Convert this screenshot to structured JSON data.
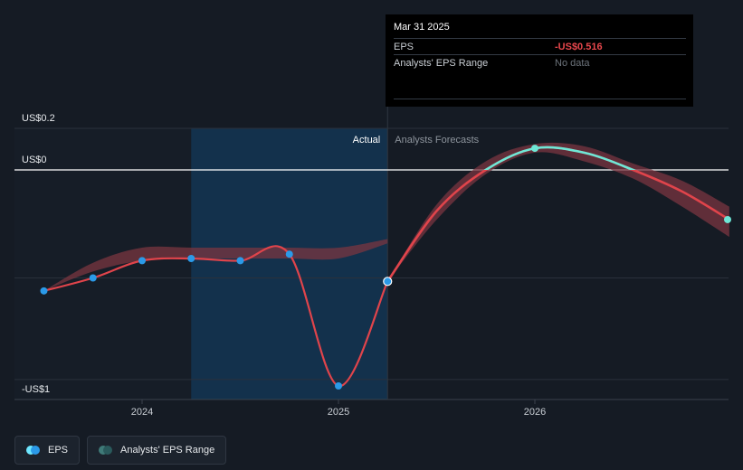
{
  "chart_data": {
    "type": "line",
    "y_tick_labels": {
      "top": "US$0.2",
      "zero": "US$0",
      "bottom": "-US$1"
    },
    "ylim": [
      -1,
      0.2
    ],
    "x_tick_labels": [
      "2024",
      "2025",
      "2026"
    ],
    "x_ticks": [
      2024.0,
      2025.0,
      2026.0
    ],
    "xlim": [
      2023.3,
      2026.99
    ],
    "actual_label": "Actual",
    "forecast_label": "Analysts Forecasts",
    "forecast_start": 2025.25,
    "highlight_start": 2024.25,
    "series": [
      {
        "name": "EPS",
        "x": [
          2023.5,
          2023.75,
          2024.0,
          2024.25,
          2024.5,
          2024.75,
          2025.0,
          2025.25
        ],
        "y": [
          -0.56,
          -0.5,
          -0.42,
          -0.41,
          -0.42,
          -0.39,
          -1.0,
          -0.516
        ]
      },
      {
        "name": "EPS forecast",
        "x": [
          2025.25,
          2025.5,
          2025.75,
          2026.0,
          2026.25,
          2026.5,
          2026.75,
          2026.99
        ],
        "y": [
          -0.516,
          -0.19,
          0.0,
          0.1,
          0.08,
          0.0,
          -0.1,
          -0.23
        ]
      }
    ],
    "range_band_hist": {
      "x": [
        2023.5,
        2023.75,
        2024.0,
        2024.25,
        2024.5,
        2024.75,
        2025.0,
        2025.25
      ],
      "low": [
        -0.56,
        -0.47,
        -0.42,
        -0.41,
        -0.41,
        -0.41,
        -0.41,
        -0.34
      ],
      "high": [
        -0.56,
        -0.43,
        -0.36,
        -0.36,
        -0.36,
        -0.36,
        -0.36,
        -0.32
      ]
    },
    "range_band_forecast": {
      "x": [
        2025.25,
        2025.5,
        2025.75,
        2026.0,
        2026.25,
        2026.5,
        2026.75,
        2026.99
      ],
      "low": [
        -0.516,
        -0.23,
        -0.02,
        0.08,
        0.04,
        -0.04,
        -0.17,
        -0.31
      ],
      "high": [
        -0.516,
        -0.16,
        0.04,
        0.12,
        0.11,
        0.03,
        -0.05,
        -0.17
      ]
    },
    "grid": true,
    "legend": "bottom-left"
  },
  "tooltip": {
    "date": "Mar 31 2025",
    "eps_label": "EPS",
    "eps_value": "-US$0.516",
    "range_label": "Analysts' EPS Range",
    "range_value": "No data"
  },
  "legend": {
    "eps_label": "EPS",
    "range_label": "Analysts' EPS Range"
  },
  "colors": {
    "background": "#151b24",
    "eps_line": "#e0444b",
    "eps_dot": "#2b9ae8",
    "forecast_positive": "#6ee7d6",
    "range_band": "#7a3540",
    "range_band_positive": "#2a6e6a",
    "highlight": "#13314c",
    "grid": "#2a313b",
    "zero_line": "#ffffff"
  }
}
